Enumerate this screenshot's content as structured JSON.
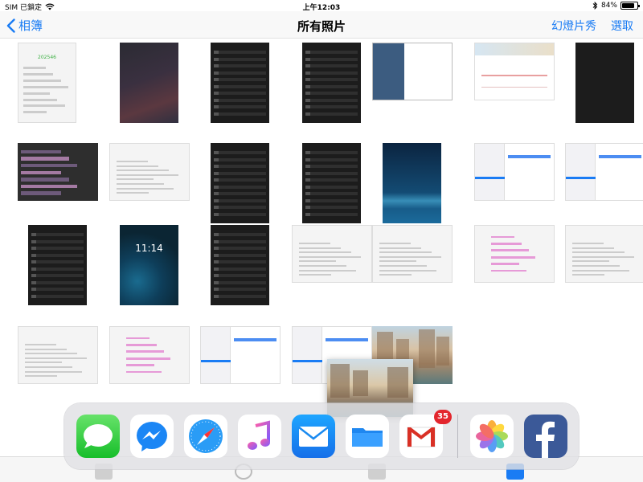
{
  "status_bar": {
    "carrier": "SIM 已鎖定",
    "time": "上午12:03",
    "battery_percent": "84%",
    "battery_level": 0.84
  },
  "nav": {
    "back_label": "相簿",
    "title": "所有照片",
    "slideshow_label": "幻燈片秀",
    "select_label": "選取"
  },
  "grid": {
    "columns": 7,
    "thumbnails": [
      {
        "kind": "light-doc",
        "text": "202546"
      },
      {
        "kind": "wallpaper-dark"
      },
      {
        "kind": "dark-list"
      },
      {
        "kind": "dark-list"
      },
      {
        "kind": "dark-ipad"
      },
      {
        "kind": "chart"
      },
      {
        "kind": "plain-dark"
      },
      {
        "kind": "darkrows"
      },
      {
        "kind": "light-doc"
      },
      {
        "kind": "dark-list"
      },
      {
        "kind": "dark-table"
      },
      {
        "kind": "blue-app"
      },
      {
        "kind": "settings"
      },
      {
        "kind": "settings"
      },
      {
        "kind": "dark-list"
      },
      {
        "kind": "wallpaper-ios",
        "text": "11:14"
      },
      {
        "kind": "dark-list"
      },
      {
        "kind": "light-doc"
      },
      {
        "kind": "light-doc"
      },
      {
        "kind": "pinklist"
      },
      {
        "kind": "light-doc"
      },
      {
        "kind": "light-doc"
      },
      {
        "kind": "pinklist"
      },
      {
        "kind": "settings"
      },
      {
        "kind": "settings"
      },
      {
        "kind": "photo-venice"
      }
    ]
  },
  "dock": {
    "apps": [
      {
        "name": "messages",
        "icon": "speech-bubble-icon"
      },
      {
        "name": "messenger",
        "icon": "messenger-bolt-icon"
      },
      {
        "name": "safari",
        "icon": "compass-icon"
      },
      {
        "name": "music",
        "icon": "music-note-icon"
      },
      {
        "name": "mail",
        "icon": "envelope-icon"
      },
      {
        "name": "files",
        "icon": "folder-icon"
      },
      {
        "name": "gmail",
        "icon": "gmail-m-icon"
      },
      {
        "name": "photos",
        "icon": "photos-flower-icon"
      },
      {
        "name": "facebook",
        "icon": "facebook-f-icon"
      }
    ],
    "gmail_badge": "35"
  },
  "colors": {
    "accent": "#1a7cf4",
    "badge": "#e3262d"
  }
}
